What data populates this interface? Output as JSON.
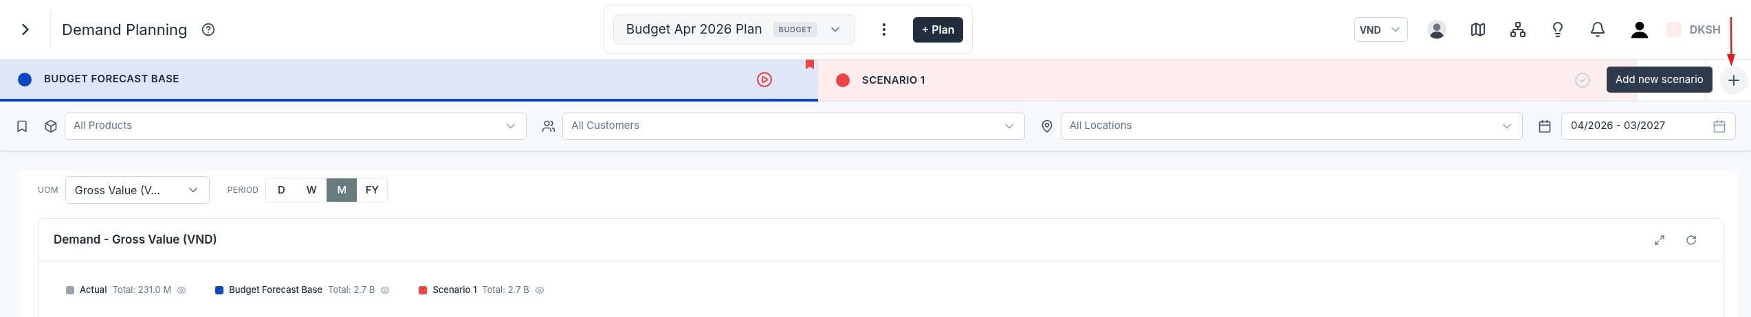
{
  "header": {
    "title": "Demand Planning",
    "plan_name": "Budget Apr 2026 Plan",
    "plan_badge": "BUDGET",
    "add_plan_button": "+ Plan",
    "currency": "VND",
    "brand": "DKSH"
  },
  "scenarios": [
    {
      "name": "BUDGET FORECAST BASE",
      "color": "#0b47c2",
      "selected": true,
      "pinned": true,
      "kind": "run"
    },
    {
      "name": "SCENARIO 1",
      "color": "#ef4444",
      "selected": false,
      "pinned": false,
      "kind": "done"
    }
  ],
  "add_scenario_tooltip": "Add new scenario",
  "filters": [
    {
      "kind": "products",
      "placeholder": "All Products"
    },
    {
      "kind": "customers",
      "placeholder": "All Customers"
    },
    {
      "kind": "locations",
      "placeholder": "All Locations"
    }
  ],
  "date_range": "04/2026 - 03/2027",
  "uom": {
    "label": "UOM",
    "value": "Gross Value (V..."
  },
  "period": {
    "label": "PERIOD",
    "options": [
      {
        "label": "D",
        "selected": false
      },
      {
        "label": "W",
        "selected": false
      },
      {
        "label": "M",
        "selected": true
      },
      {
        "label": "FY",
        "selected": false
      }
    ]
  },
  "card": {
    "title": "Demand - Gross Value (VND)",
    "legend": [
      {
        "name": "Actual",
        "total": "Total: 231.0 M",
        "color": "#9ca3af"
      },
      {
        "name": "Budget Forecast Base",
        "total": "Total: 2.7 B",
        "color": "#0b47c2"
      },
      {
        "name": "Scenario 1",
        "total": "Total: 2.7 B",
        "color": "#ef4444"
      }
    ]
  }
}
